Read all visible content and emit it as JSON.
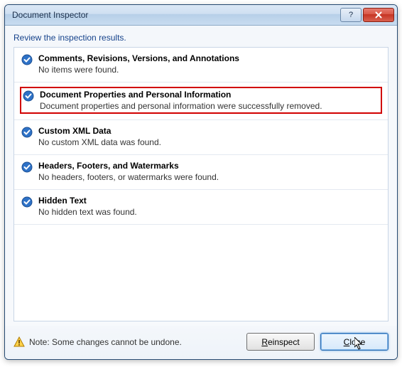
{
  "window": {
    "title": "Document Inspector"
  },
  "instructions": "Review the inspection results.",
  "results": [
    {
      "title": "Comments, Revisions, Versions, and Annotations",
      "desc": "No items were found.",
      "highlighted": false
    },
    {
      "title": "Document Properties and Personal Information",
      "desc": "Document properties and personal information were successfully removed.",
      "highlighted": true
    },
    {
      "title": "Custom XML Data",
      "desc": "No custom XML data was found.",
      "highlighted": false
    },
    {
      "title": "Headers, Footers, and Watermarks",
      "desc": "No headers, footers, or watermarks were found.",
      "highlighted": false
    },
    {
      "title": "Hidden Text",
      "desc": "No hidden text was found.",
      "highlighted": false
    }
  ],
  "footer": {
    "note": "Note: Some changes cannot be undone."
  },
  "buttons": {
    "reinspect_prefix": "R",
    "reinspect_rest": "einspect",
    "close_prefix": "C",
    "close_rest": "lose"
  },
  "titlebar": {
    "help_glyph": "?",
    "close_label": "Close"
  }
}
